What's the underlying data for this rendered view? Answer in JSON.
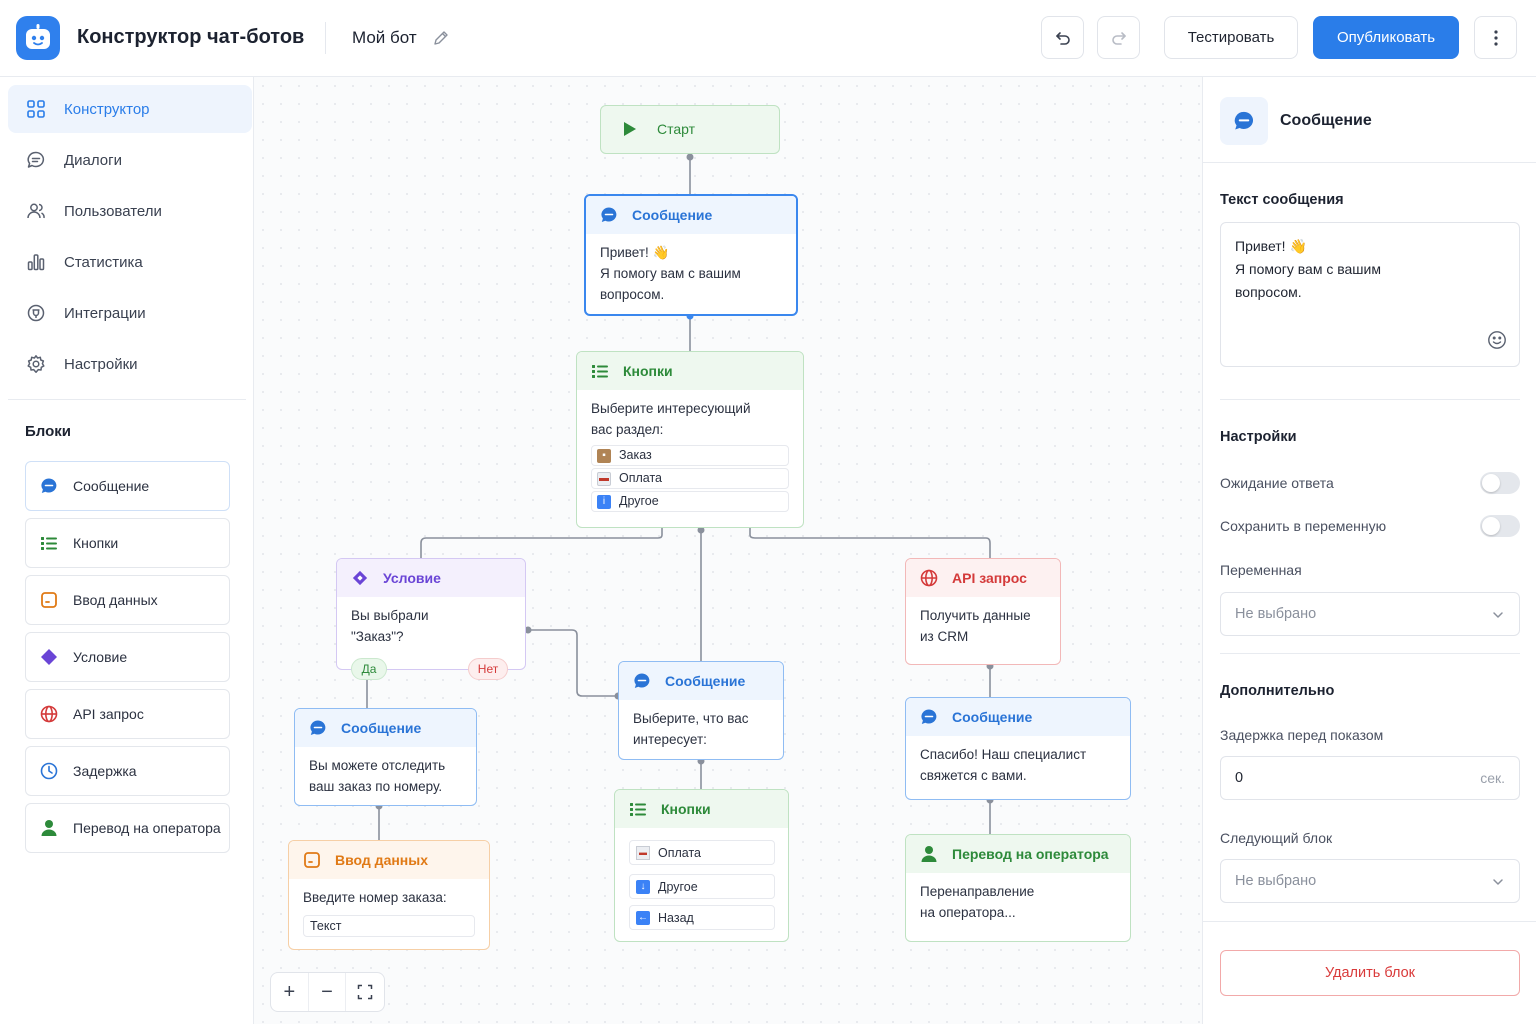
{
  "header": {
    "app_title": "Конструктор чат-ботов",
    "bot_name": "Мой бот",
    "test_label": "Тестировать",
    "publish_label": "Опубликовать"
  },
  "sidebar": {
    "nav": [
      {
        "label": "Конструктор",
        "icon": "grid-icon",
        "active": true
      },
      {
        "label": "Диалоги",
        "icon": "chat-icon"
      },
      {
        "label": "Пользователи",
        "icon": "users-icon"
      },
      {
        "label": "Статистика",
        "icon": "bar-chart-icon"
      },
      {
        "label": "Интеграции",
        "icon": "integration-icon"
      },
      {
        "label": "Настройки",
        "icon": "gear-icon"
      }
    ],
    "blocks_title": "Блоки",
    "blocks": [
      {
        "label": "Сообщение",
        "icon": "message-icon"
      },
      {
        "label": "Кнопки",
        "icon": "list-icon"
      },
      {
        "label": "Ввод данных",
        "icon": "input-icon"
      },
      {
        "label": "Условие",
        "icon": "diamond-icon"
      },
      {
        "label": "API запрос",
        "icon": "globe-icon"
      },
      {
        "label": "Задержка",
        "icon": "clock-icon"
      },
      {
        "label": "Перевод на оператора",
        "icon": "person-icon"
      }
    ]
  },
  "canvas": {
    "start": {
      "title": "Старт"
    },
    "msg1": {
      "title": "Сообщение",
      "lines": [
        "Привет! 👋",
        "Я помогу вам с вашим",
        "вопросом."
      ]
    },
    "buttons1": {
      "title": "Кнопки",
      "lines": [
        "Выберите интересующий",
        "вас раздел:"
      ],
      "options": [
        "Заказ",
        "Оплата",
        "Другое"
      ]
    },
    "cond": {
      "title": "Условие",
      "lines": [
        "Вы выбрали",
        "\"Заказ\"?"
      ],
      "yes": "Да",
      "no": "Нет"
    },
    "api": {
      "title": "API запрос",
      "lines": [
        "Получить данные",
        "из CRM"
      ]
    },
    "msg_center": {
      "title": "Сообщение",
      "lines": [
        "Выберите, что вас",
        "интересует:"
      ]
    },
    "msg_left": {
      "title": "Сообщение",
      "lines": [
        "Вы можете отследить",
        "ваш заказ по номеру."
      ]
    },
    "msg_right": {
      "title": "Сообщение",
      "lines": [
        "Спасибо! Наш специалист",
        "свяжется с вами."
      ]
    },
    "input": {
      "title": "Ввод данных",
      "prompt": "Введите номер заказа:",
      "field": "Текст"
    },
    "buttons2": {
      "title": "Кнопки",
      "options": [
        "Оплата",
        "Другое",
        "Назад"
      ]
    },
    "operator": {
      "title": "Перевод на оператора",
      "lines": [
        "Перенаправление",
        "на оператора..."
      ]
    },
    "zoom": {
      "plus": "+",
      "minus": "−"
    }
  },
  "panel": {
    "title": "Сообщение",
    "text_label": "Текст сообщения",
    "text_lines": [
      "Привет! 👋",
      "Я помогу вам с вашим",
      "вопросом."
    ],
    "settings_title": "Настройки",
    "wait_label": "Ожидание ответа",
    "wait_on": false,
    "save_var_label": "Сохранить в переменную",
    "save_var_on": false,
    "variable_label": "Переменная",
    "variable_value": "Не выбрано",
    "extra_title": "Дополнительно",
    "delay_label": "Задержка перед показом",
    "delay_value": "0",
    "delay_unit": "сек.",
    "next_label": "Следующий блок",
    "next_value": "Не выбрано",
    "delete_label": "Удалить блок"
  },
  "colors": {
    "primary": "#2a7de9",
    "message": "#2a74d6",
    "buttons": "#2d8a3a",
    "condition": "#6a45d6",
    "api": "#d43a3a",
    "input": "#e07a16"
  }
}
